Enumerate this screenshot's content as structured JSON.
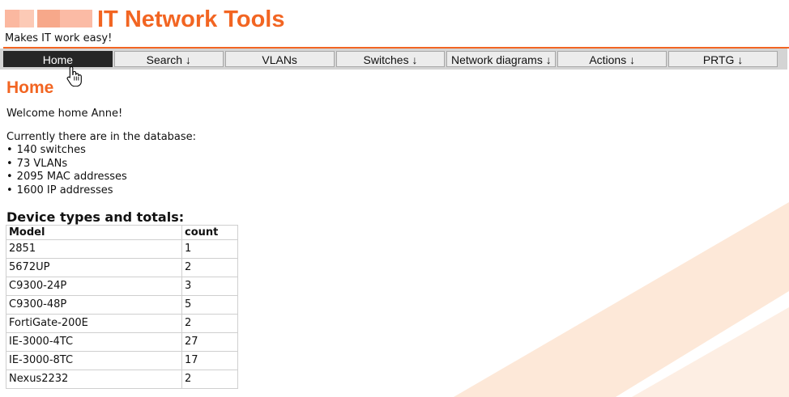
{
  "header": {
    "title": "IT Network Tools",
    "tagline": "Makes IT work easy!",
    "accent_color": "#f26522"
  },
  "nav": {
    "items": [
      {
        "label": "Home",
        "active": true
      },
      {
        "label": "Search ↓"
      },
      {
        "label": "VLANs"
      },
      {
        "label": "Switches ↓"
      },
      {
        "label": "Network diagrams ↓"
      },
      {
        "label": "Actions ↓"
      },
      {
        "label": "PRTG ↓"
      }
    ]
  },
  "main": {
    "title": "Home",
    "welcome": "Welcome home Anne!",
    "db_intro": "Currently there are in the database:",
    "stats": [
      "140 switches",
      "73 VLANs",
      "2095 MAC addresses",
      "1600 IP addresses"
    ],
    "device_section_title": "Device types and totals:",
    "device_table": {
      "headers": [
        "Model",
        "count"
      ],
      "rows": [
        [
          "2851",
          "1"
        ],
        [
          "5672UP",
          "2"
        ],
        [
          "C9300-24P",
          "3"
        ],
        [
          "C9300-48P",
          "5"
        ],
        [
          "FortiGate-200E",
          "2"
        ],
        [
          "IE-3000-4TC",
          "27"
        ],
        [
          "IE-3000-8TC",
          "17"
        ],
        [
          "Nexus2232",
          "2"
        ]
      ]
    }
  },
  "cursor": "hand-pointer-icon"
}
